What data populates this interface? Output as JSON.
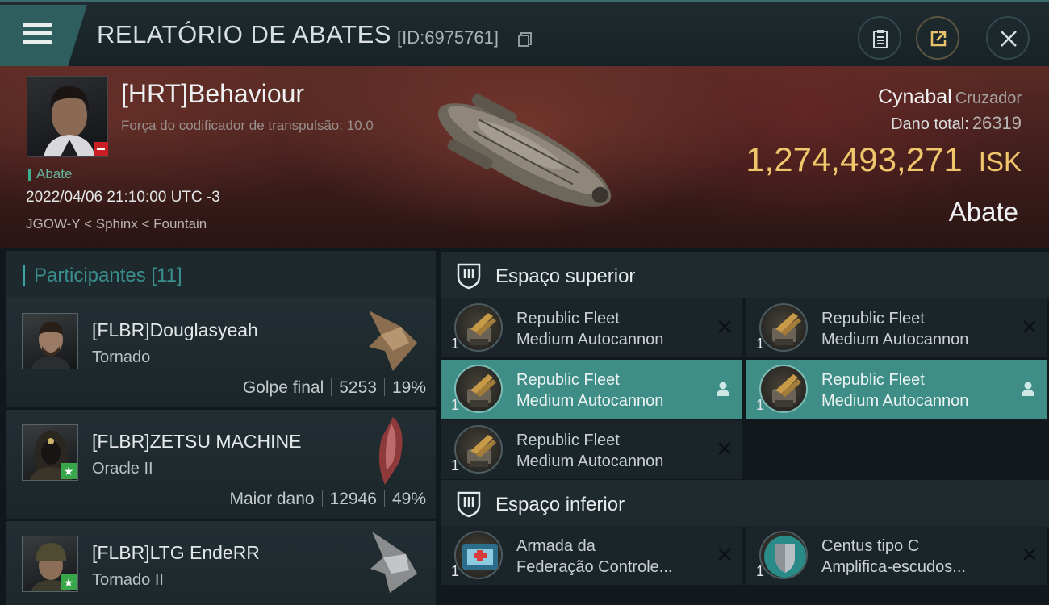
{
  "header": {
    "title": "RELATÓRIO DE ABATES",
    "report_id": "[ID:6975761]"
  },
  "victim": {
    "name": "[HRT]Behaviour",
    "subtitle": "Força do codificador de transpulsão: 10.0",
    "tag": "Abate",
    "datetime": "2022/04/06 21:10:00 UTC -3",
    "location": "JGOW-Y < Sphinx < Fountain",
    "ship_name": "Cynabal",
    "ship_class": "Cruzador",
    "damage_label": "Dano total:",
    "damage_value": "26319",
    "isk_value": "1,274,493,271",
    "isk_unit": "ISK",
    "kill_label": "Abate"
  },
  "participants": {
    "header": "Participantes [11]",
    "rows": [
      {
        "name": "[FLBR]Douglasyeah",
        "ship": "Tornado",
        "label": "Golpe final",
        "damage": "5253",
        "percent": "19%",
        "badge": false
      },
      {
        "name": "[FLBR]ZETSU MACHINE",
        "ship": "Oracle II",
        "label": "Maior dano",
        "damage": "12946",
        "percent": "49%",
        "badge": true
      },
      {
        "name": "[FLBR]LTG EndeRR",
        "ship": "Tornado II",
        "label": "",
        "damage": "",
        "percent": "",
        "badge": true
      }
    ]
  },
  "fitting": {
    "high_slots_label": "Espaço superior",
    "low_slots_label": "Espaço inferior",
    "high": [
      {
        "name": "Republic Fleet\nMedium Autocannon",
        "qty": "1",
        "state": "destroyed"
      },
      {
        "name": "Republic Fleet\nMedium Autocannon",
        "qty": "1",
        "state": "destroyed"
      },
      {
        "name": "Republic Fleet\nMedium Autocannon",
        "qty": "1",
        "state": "dropped"
      },
      {
        "name": "Republic Fleet\nMedium Autocannon",
        "qty": "1",
        "state": "dropped"
      },
      {
        "name": "Republic Fleet\nMedium Autocannon",
        "qty": "1",
        "state": "destroyed"
      }
    ],
    "low": [
      {
        "name": "Armada da\nFederação Controle...",
        "qty": "1",
        "state": "destroyed"
      },
      {
        "name": "Centus tipo C\nAmplifica-escudos...",
        "qty": "1",
        "state": "destroyed"
      }
    ]
  },
  "colors": {
    "accent_teal": "#3e8d86",
    "isk_gold": "#f0c66c",
    "badge_red": "#c81e24",
    "badge_green": "#3aa64a"
  },
  "icons": [
    "menu-icon",
    "copy-icon",
    "clipboard-icon",
    "share-icon",
    "close-icon",
    "shield-slot-icon",
    "remove-icon",
    "user-icon"
  ]
}
